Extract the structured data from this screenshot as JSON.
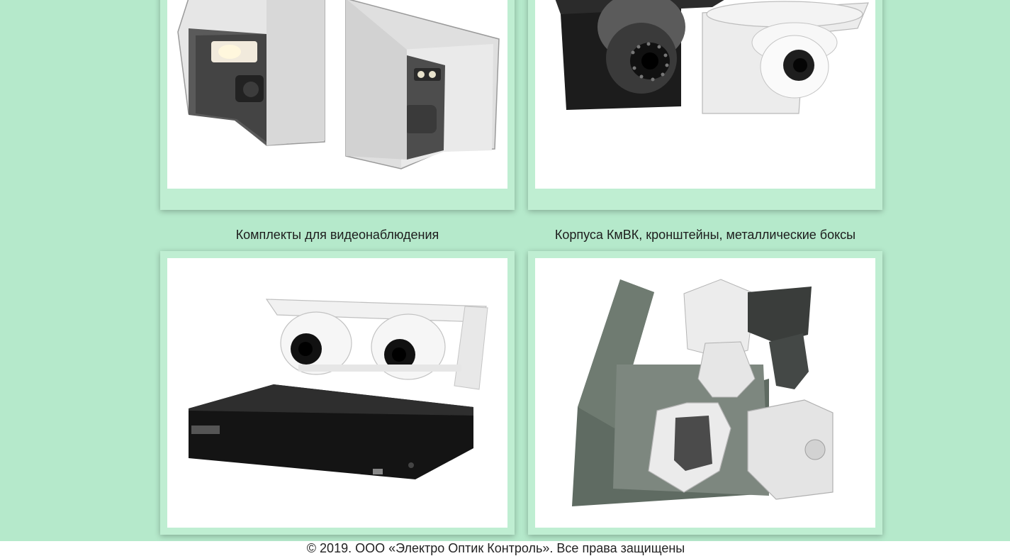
{
  "categories": [
    {
      "id": "cameras-in-housings",
      "caption": "",
      "image_alt": "Камеры в защитных корпусах"
    },
    {
      "id": "dome-cameras-in-boxes",
      "caption": "",
      "image_alt": "Купольные камеры в кожухах"
    },
    {
      "id": "surveillance-kits",
      "caption": "Комплекты для видеонаблюдения",
      "image_alt": "Комплект: две купольные камеры и видеорегистратор"
    },
    {
      "id": "housings-brackets",
      "caption": "Корпуса КмВК, кронштейны, металлические боксы",
      "image_alt": "Металлические корпуса и кронштейны"
    }
  ],
  "footer": {
    "copyright": "© 2019. ООО «Электро Оптик Контроль». Все права защищены"
  },
  "colors": {
    "background": "#b5e9cb",
    "card_frame": "#bfeed2",
    "footer_bg": "#ffffff"
  }
}
